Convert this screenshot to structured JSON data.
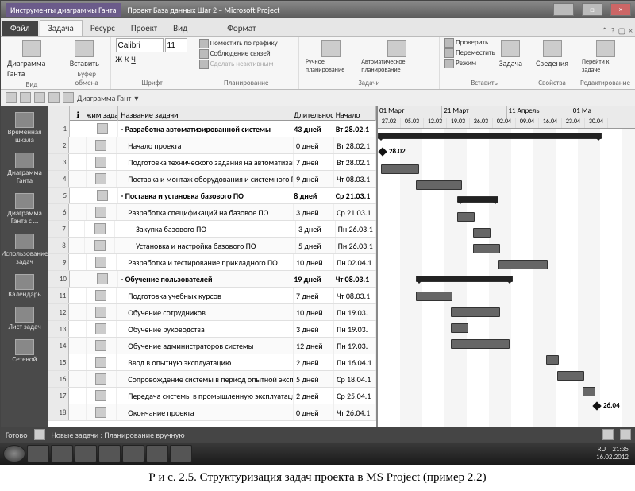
{
  "window": {
    "contextTab": "Инструменты диаграммы Ганта",
    "title": "Проект База данных Шаг 2 – Microsoft Project"
  },
  "menu": {
    "file": "Файл",
    "tabs": [
      "Задача",
      "Ресурс",
      "Проект",
      "Вид",
      "Формат"
    ]
  },
  "ribbon": {
    "view": {
      "label": "Вид",
      "btn": "Диаграмма Ганта"
    },
    "clipboard": {
      "label": "Буфер обмена",
      "btn": "Вставить"
    },
    "font": {
      "label": "Шрифт",
      "name": "Calibri",
      "size": "11"
    },
    "schedule": {
      "label": "Планирование",
      "i1": "Поместить по графику",
      "i2": "Соблюдение связей",
      "i3": "Сделать неактивным"
    },
    "tasks": {
      "label": "Задачи",
      "b1": "Ручное планирование",
      "b2": "Автоматическое планирование"
    },
    "insert": {
      "label": "Вставить",
      "btn": "Задача",
      "i1": "Проверить",
      "i2": "Переместить",
      "i3": "Режим"
    },
    "props": {
      "label": "Свойства",
      "btn": "Сведения"
    },
    "edit": {
      "label": "Редактирование",
      "btn": "Перейти к задаче"
    }
  },
  "toolbar": {
    "gantt": "Диаграмма Гант"
  },
  "sidebar": [
    "Временная шкала",
    "Диаграмма Ганта",
    "Диаграмма Ганта с …",
    "Использование задач",
    "Календарь",
    "Лист задач",
    "Сетевой"
  ],
  "columns": {
    "mode": "Режим задачи",
    "name": "Название задачи",
    "dur": "Длительност",
    "start": "Начало"
  },
  "timescale": {
    "months": [
      "01 Март",
      "21 Март",
      "11 Апрель",
      "01 Ма"
    ],
    "days": [
      "27.02",
      "05.03",
      "12.03",
      "19.03",
      "26.03",
      "02.04",
      "09.04",
      "16.04",
      "23.04",
      "30.04"
    ]
  },
  "milestones": {
    "start": "28.02",
    "end": "26.04"
  },
  "tasks": [
    {
      "id": 1,
      "lvl": 0,
      "bold": true,
      "name": "- Разработка автоматизированной системы",
      "dur": "43 дней",
      "start": "Вт 28.02.1",
      "bar": [
        0,
        280
      ],
      "sum": true
    },
    {
      "id": 2,
      "lvl": 1,
      "name": "Начало проекта",
      "dur": "0 дней",
      "start": "Вт 28.02.1",
      "mile": 2
    },
    {
      "id": 3,
      "lvl": 1,
      "name": "Подготовка технического задания на автоматизацию",
      "dur": "7 дней",
      "start": "Вт 28.02.1",
      "bar": [
        4,
        46
      ]
    },
    {
      "id": 4,
      "lvl": 1,
      "name": "Поставка и монтаж оборудования и системного ПО",
      "dur": "9 дней",
      "start": "Чт 08.03.1",
      "bar": [
        48,
        56
      ]
    },
    {
      "id": 5,
      "lvl": 0,
      "bold": true,
      "name": "- Поставка и установка базового ПО",
      "dur": "8 дней",
      "start": "Ср 21.03.1",
      "bar": [
        100,
        50
      ],
      "sum": true
    },
    {
      "id": 6,
      "lvl": 1,
      "name": "Разработка спецификаций на базовое ПО",
      "dur": "3 дней",
      "start": "Ср 21.03.1",
      "bar": [
        100,
        20
      ]
    },
    {
      "id": 7,
      "lvl": 2,
      "name": "Закупка базового ПО",
      "dur": "3 дней",
      "start": "Пн 26.03.1",
      "bar": [
        120,
        20
      ]
    },
    {
      "id": 8,
      "lvl": 2,
      "name": "Установка и настройка базового ПО",
      "dur": "5 дней",
      "start": "Пн 26.03.1",
      "bar": [
        120,
        32
      ]
    },
    {
      "id": 9,
      "lvl": 1,
      "name": "Разработка и тестирование прикладного ПО",
      "dur": "10 дней",
      "start": "Пн 02.04.1",
      "bar": [
        152,
        60
      ]
    },
    {
      "id": 10,
      "lvl": 0,
      "bold": true,
      "name": "- Обучение пользователей",
      "dur": "19 дней",
      "start": "Чт 08.03.1",
      "bar": [
        48,
        120
      ],
      "sum": true
    },
    {
      "id": 11,
      "lvl": 1,
      "name": "Подготовка учебных курсов",
      "dur": "7 дней",
      "start": "Чт 08.03.1",
      "bar": [
        48,
        44
      ]
    },
    {
      "id": 12,
      "lvl": 1,
      "name": "Обучение сотрудников",
      "dur": "10 дней",
      "start": "Пн 19.03.",
      "bar": [
        92,
        60
      ]
    },
    {
      "id": 13,
      "lvl": 1,
      "name": "Обучение руководства",
      "dur": "3 дней",
      "start": "Пн 19.03.",
      "bar": [
        92,
        20
      ]
    },
    {
      "id": 14,
      "lvl": 1,
      "name": "Обучение администраторов системы",
      "dur": "12 дней",
      "start": "Пн 19.03.",
      "bar": [
        92,
        72
      ]
    },
    {
      "id": 15,
      "lvl": 1,
      "name": "Ввод в опытную эксплуатацию",
      "dur": "2 дней",
      "start": "Пн 16.04.1",
      "bar": [
        212,
        14
      ]
    },
    {
      "id": 16,
      "lvl": 1,
      "name": "Сопровождение системы в период опытной эксплуатации",
      "dur": "5 дней",
      "start": "Ср 18.04.1",
      "bar": [
        226,
        32
      ]
    },
    {
      "id": 17,
      "lvl": 1,
      "name": "Передача системы в промышленную эксплуатацию",
      "dur": "2 дней",
      "start": "Ср 25.04.1",
      "bar": [
        258,
        14
      ]
    },
    {
      "id": 18,
      "lvl": 1,
      "name": "Окончание проекта",
      "dur": "0 дней",
      "start": "Чт 26.04.1",
      "mile": 272
    }
  ],
  "status": {
    "ready": "Готово",
    "mode": "Новые задачи : Планирование вручную",
    "lang": "RU"
  },
  "tray": {
    "time": "21:35",
    "date": "16.02.2012"
  },
  "caption": "Р и с. 2.5. Структуризация задач проекта в MS Project (пример 2.2)"
}
